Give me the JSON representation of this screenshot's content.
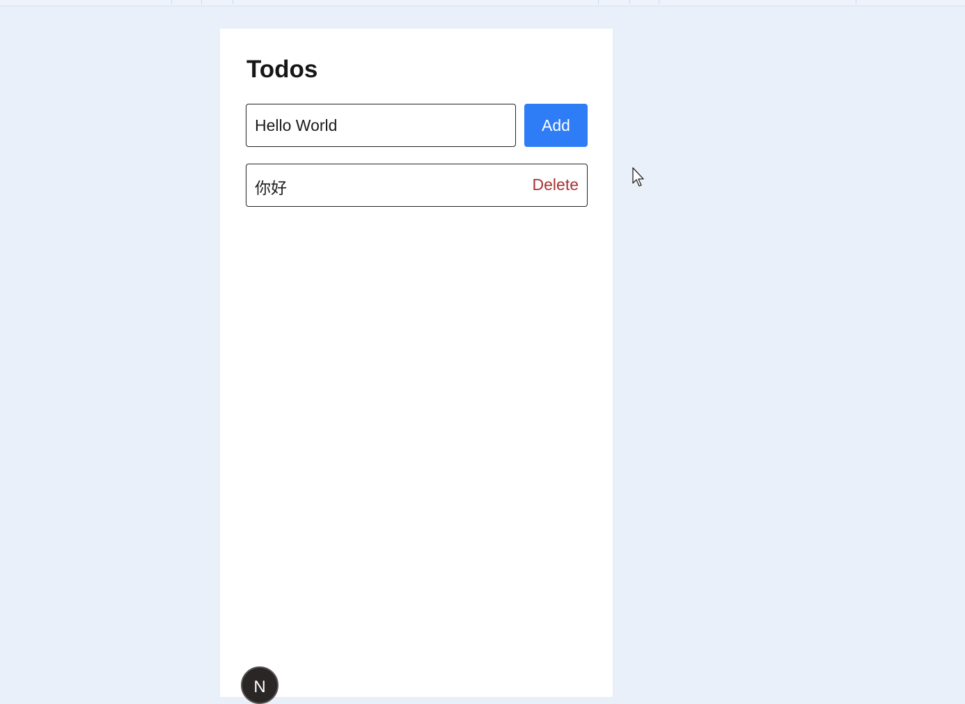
{
  "page": {
    "title": "Todos"
  },
  "form": {
    "input_value": "Hello World",
    "add_label": "Add"
  },
  "todos": [
    {
      "text": "你好",
      "delete_label": "Delete"
    }
  ],
  "badge": {
    "letter": "N",
    "icon": "nextjs-logo-icon"
  },
  "colors": {
    "background": "#eaf0fa",
    "card": "#ffffff",
    "primary_button": "#2e7cf6",
    "delete_text": "#a83232"
  }
}
